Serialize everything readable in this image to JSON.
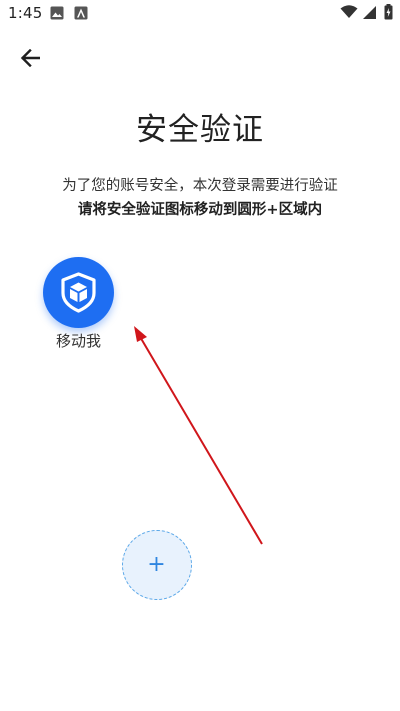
{
  "status_bar": {
    "time": "1:45",
    "left_icons": [
      "photo-icon",
      "a-notification-icon"
    ],
    "right_icons": [
      "wifi-icon",
      "signal-icon",
      "battery-charging-icon"
    ]
  },
  "nav": {
    "back_icon": "arrow-left-icon"
  },
  "page": {
    "title": "安全验证",
    "subtitle": "为了您的账号安全，本次登录需要进行验证",
    "instruction": "请将安全验证图标移动到圆形+区域内"
  },
  "drag_item": {
    "icon": "shield-cube-icon",
    "label": "移动我",
    "color": "#1e6ef2"
  },
  "target": {
    "symbol": "+",
    "border_color": "#5aa7e8",
    "fill_color": "#e8f2fd"
  },
  "arrow": {
    "color": "#d0161b"
  }
}
